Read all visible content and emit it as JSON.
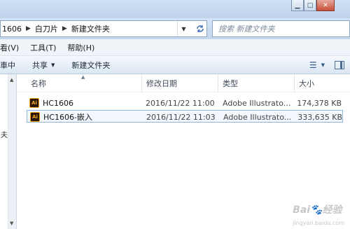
{
  "address": {
    "crumbs": [
      "1606",
      "白刀片",
      "新建文件夹"
    ],
    "search_placeholder": "搜索 新建文件夹"
  },
  "menu": {
    "items": [
      "看(V)",
      "工具(T)",
      "帮助(H)"
    ]
  },
  "commands": {
    "items": [
      "車中",
      "共享",
      "新建文件夹"
    ]
  },
  "columns": {
    "name": "名称",
    "date": "修改日期",
    "type": "类型",
    "size": "大小"
  },
  "files": [
    {
      "name": "HC1606",
      "date": "2016/11/22 11:00",
      "type": "Adobe Illustrato...",
      "size": "174,378 KB",
      "icon": "ai-file-icon"
    },
    {
      "name": "HC1606-嵌入",
      "date": "2016/11/22 11:03",
      "type": "Adobe Illustrato...",
      "size": "333,635 KB",
      "icon": "ai-file-icon"
    }
  ],
  "watermark": {
    "brand": "Bai",
    "suffix": "经验",
    "sub": "jingyan.baidu.com"
  },
  "colors": {
    "selection_border": "#8fb4dd",
    "selection_fill": "#f3f8fe",
    "chrome": "#cfe0f2"
  }
}
